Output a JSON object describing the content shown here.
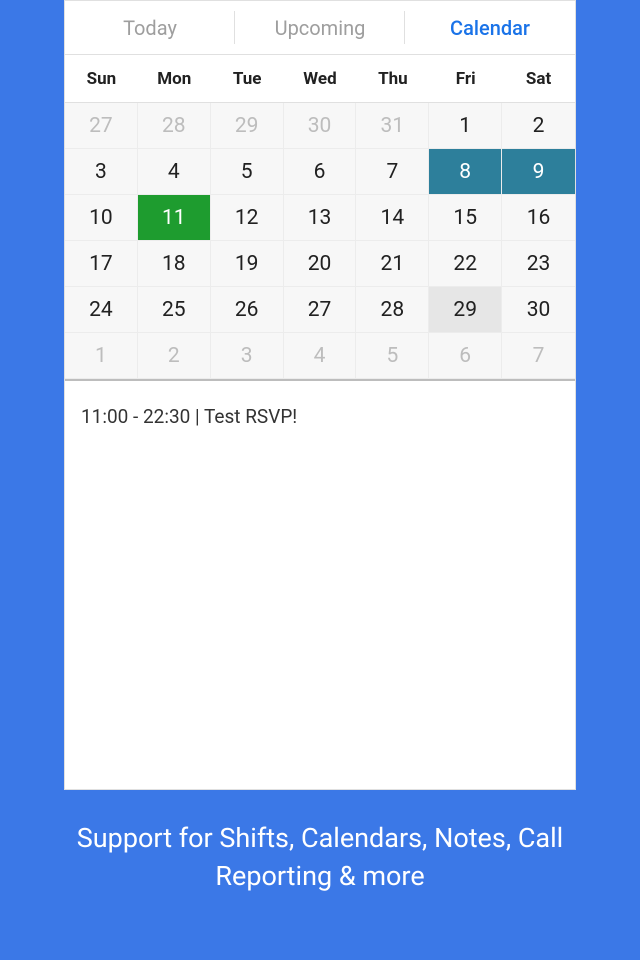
{
  "tabs": [
    {
      "label": "Today",
      "active": false
    },
    {
      "label": "Upcoming",
      "active": false
    },
    {
      "label": "Calendar",
      "active": true
    }
  ],
  "day_headers": [
    "Sun",
    "Mon",
    "Tue",
    "Wed",
    "Thu",
    "Fri",
    "Sat"
  ],
  "weeks": [
    [
      {
        "d": "27",
        "cls": "other-month"
      },
      {
        "d": "28",
        "cls": "other-month"
      },
      {
        "d": "29",
        "cls": "other-month"
      },
      {
        "d": "30",
        "cls": "other-month"
      },
      {
        "d": "31",
        "cls": "other-month"
      },
      {
        "d": "1",
        "cls": ""
      },
      {
        "d": "2",
        "cls": ""
      }
    ],
    [
      {
        "d": "3",
        "cls": ""
      },
      {
        "d": "4",
        "cls": ""
      },
      {
        "d": "5",
        "cls": ""
      },
      {
        "d": "6",
        "cls": ""
      },
      {
        "d": "7",
        "cls": ""
      },
      {
        "d": "8",
        "cls": "highlighted"
      },
      {
        "d": "9",
        "cls": "highlighted"
      }
    ],
    [
      {
        "d": "10",
        "cls": ""
      },
      {
        "d": "11",
        "cls": "selected"
      },
      {
        "d": "12",
        "cls": ""
      },
      {
        "d": "13",
        "cls": ""
      },
      {
        "d": "14",
        "cls": ""
      },
      {
        "d": "15",
        "cls": ""
      },
      {
        "d": "16",
        "cls": ""
      }
    ],
    [
      {
        "d": "17",
        "cls": ""
      },
      {
        "d": "18",
        "cls": ""
      },
      {
        "d": "19",
        "cls": ""
      },
      {
        "d": "20",
        "cls": ""
      },
      {
        "d": "21",
        "cls": ""
      },
      {
        "d": "22",
        "cls": ""
      },
      {
        "d": "23",
        "cls": ""
      }
    ],
    [
      {
        "d": "24",
        "cls": ""
      },
      {
        "d": "25",
        "cls": ""
      },
      {
        "d": "26",
        "cls": ""
      },
      {
        "d": "27",
        "cls": ""
      },
      {
        "d": "28",
        "cls": ""
      },
      {
        "d": "29",
        "cls": "today-box"
      },
      {
        "d": "30",
        "cls": ""
      }
    ],
    [
      {
        "d": "1",
        "cls": "other-month"
      },
      {
        "d": "2",
        "cls": "other-month"
      },
      {
        "d": "3",
        "cls": "other-month"
      },
      {
        "d": "4",
        "cls": "other-month"
      },
      {
        "d": "5",
        "cls": "other-month"
      },
      {
        "d": "6",
        "cls": "other-month"
      },
      {
        "d": "7",
        "cls": "other-month"
      }
    ]
  ],
  "events": [
    "11:00 - 22:30 | Test RSVP!"
  ],
  "caption": "Support for Shifts, Calendars, Notes, Call Reporting & more"
}
